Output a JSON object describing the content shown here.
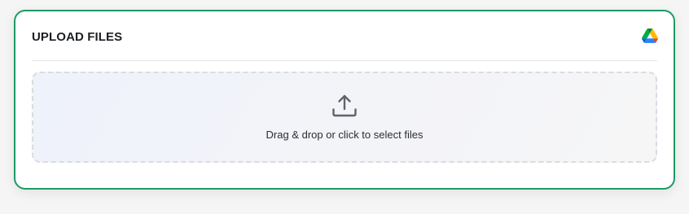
{
  "upload": {
    "title": "UPLOAD FILES",
    "drive_icon": "google-drive-icon",
    "dropzone_icon": "upload-icon",
    "dropzone_text": "Drag & drop or click to select files"
  },
  "colors": {
    "accent_border": "#1e9a68",
    "page_background": "#f4f5f4",
    "dropzone_border": "#d9dcdf"
  }
}
